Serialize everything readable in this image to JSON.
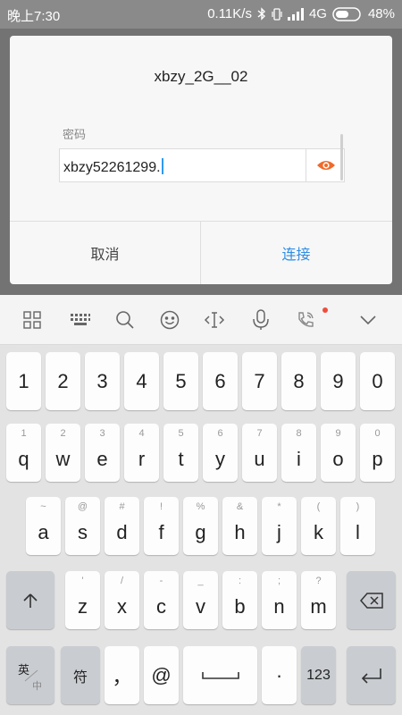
{
  "status_bar": {
    "time": "晚上7:30",
    "network_speed": "0.11K/s",
    "network_type": "4G",
    "battery": "48%"
  },
  "dialog": {
    "title": "xbzy_2G__02",
    "password_label": "密码",
    "password_value": "xbzy52261299.",
    "cancel_label": "取消",
    "connect_label": "连接",
    "show_password_icon": "eye-icon"
  },
  "keyboard_toolbar": {
    "icons": [
      "grid-menu-icon",
      "keyboard-icon",
      "search-icon",
      "emoji-icon",
      "cursor-move-icon",
      "microphone-icon",
      "phone-signal-icon",
      "chevron-down-icon"
    ]
  },
  "keyboard": {
    "number_row": [
      "1",
      "2",
      "3",
      "4",
      "5",
      "6",
      "7",
      "8",
      "9",
      "0"
    ],
    "row1": [
      {
        "main": "q",
        "sub": "1"
      },
      {
        "main": "w",
        "sub": "2"
      },
      {
        "main": "e",
        "sub": "3"
      },
      {
        "main": "r",
        "sub": "4"
      },
      {
        "main": "t",
        "sub": "5"
      },
      {
        "main": "y",
        "sub": "6"
      },
      {
        "main": "u",
        "sub": "7"
      },
      {
        "main": "i",
        "sub": "8"
      },
      {
        "main": "o",
        "sub": "9"
      },
      {
        "main": "p",
        "sub": "0"
      }
    ],
    "row2": [
      {
        "main": "a",
        "sub": "~"
      },
      {
        "main": "s",
        "sub": "@"
      },
      {
        "main": "d",
        "sub": "#"
      },
      {
        "main": "f",
        "sub": "!"
      },
      {
        "main": "g",
        "sub": "%"
      },
      {
        "main": "h",
        "sub": "&"
      },
      {
        "main": "j",
        "sub": "*"
      },
      {
        "main": "k",
        "sub": "("
      },
      {
        "main": "l",
        "sub": ")"
      }
    ],
    "row3": [
      {
        "main": "z",
        "sub": "'"
      },
      {
        "main": "x",
        "sub": "/"
      },
      {
        "main": "c",
        "sub": "-"
      },
      {
        "main": "v",
        "sub": "_"
      },
      {
        "main": "b",
        "sub": ":"
      },
      {
        "main": "n",
        "sub": ";"
      },
      {
        "main": "m",
        "sub": "?"
      }
    ],
    "bottom_row": {
      "lang_top": "英",
      "lang_bottom": "中",
      "symbol": "符",
      "comma": "，",
      "at": "@",
      "period": "·",
      "numbers": "123"
    }
  }
}
